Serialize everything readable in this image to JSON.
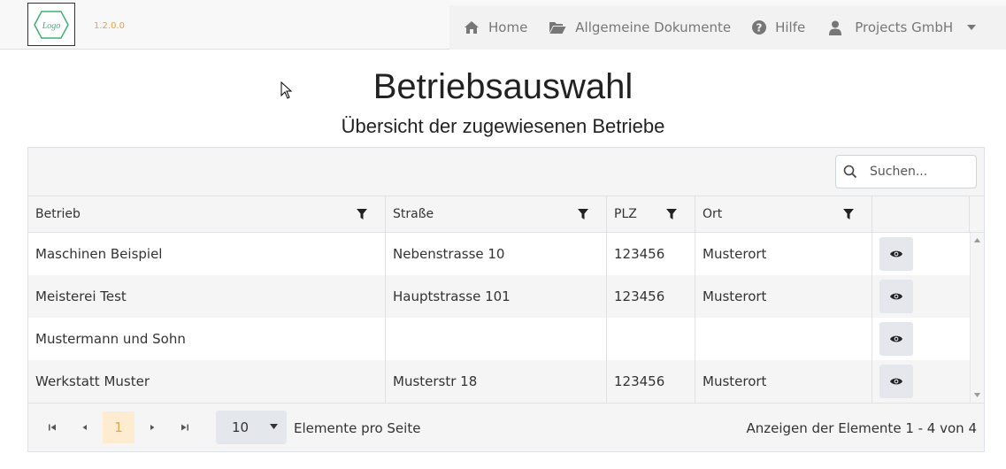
{
  "app": {
    "logo_text": "Logo",
    "version": "1.2.0.0"
  },
  "nav": {
    "items": [
      {
        "label": "Home",
        "icon": "home-icon"
      },
      {
        "label": "Allgemeine Dokumente",
        "icon": "folder-open-icon"
      },
      {
        "label": "Hilfe",
        "icon": "help-circle-icon"
      },
      {
        "label": "Projects GmbH",
        "icon": "user-icon"
      }
    ]
  },
  "page": {
    "title": "Betriebsauswahl",
    "subtitle": "Übersicht der zugewiesenen Betriebe"
  },
  "search": {
    "placeholder": "Suchen..."
  },
  "table": {
    "columns": [
      "Betrieb",
      "Straße",
      "PLZ",
      "Ort",
      ""
    ],
    "rows": [
      {
        "betrieb": "Maschinen Beispiel",
        "strasse": "Nebenstrasse 10",
        "plz": "123456",
        "ort": "Musterort"
      },
      {
        "betrieb": "Meisterei Test",
        "strasse": "Hauptstrasse 101",
        "plz": "123456",
        "ort": "Musterort"
      },
      {
        "betrieb": "Mustermann und Sohn",
        "strasse": "",
        "plz": "",
        "ort": ""
      },
      {
        "betrieb": "Werkstatt Muster",
        "strasse": "Musterstr 18",
        "plz": "123456",
        "ort": "Musterort"
      }
    ]
  },
  "pager": {
    "current_page": "1",
    "page_size": "10",
    "page_size_label": "Elemente pro Seite",
    "info": "Anzeigen der Elemente 1 - 4 von 4"
  },
  "colors": {
    "accent": "#e8a740",
    "accent_bg": "#fdecd0",
    "logo_green": "#3cb371",
    "version": "#f0a030"
  }
}
